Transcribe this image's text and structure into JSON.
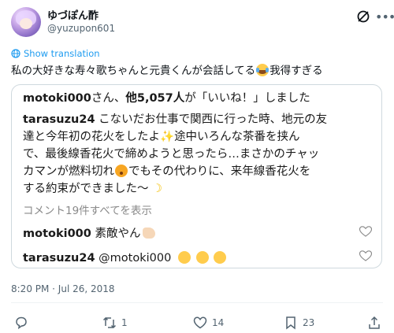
{
  "author": {
    "display_name": "ゆづぽん酢",
    "handle": "@yuzupon601"
  },
  "translate_label": "Show translation",
  "tweet_text": "私の大好きな寿々歌ちゃんと元貴くんが会話してる",
  "tweet_text_after": "我得すぎる",
  "card": {
    "likes_line_user": "motoki000",
    "likes_line_mid": "さん、",
    "likes_line_count": "他5,057人",
    "likes_line_end": "が「いいね！」しました",
    "comment_user": "tarasuzu24",
    "comment_lines": [
      "こないだお仕事で関西に行った時、地元の友",
      "達と今年初の花火をしたよ",
      "途中いろんな茶番を挟ん",
      "で、最後線香花火で締めようと思ったら…まさかのチャッ",
      "カマンが燃料切れ",
      "でもその代わりに、来年線香花火を",
      "する約束ができました〜"
    ],
    "view_all": "コメント19件すべてを表示",
    "reply1_user": "motoki000",
    "reply1_text": "素敵やん",
    "reply2_user": "tarasuzu24",
    "reply2_text": "@motoki000"
  },
  "timestamp": "8:20 PM · Jul 26, 2018",
  "actions": {
    "retweets": "1",
    "likes": "14",
    "bookmarks": "23"
  },
  "colors": {
    "accent": "#1d9bf0",
    "secondary_text": "#536471",
    "border": "#cfd9de"
  }
}
